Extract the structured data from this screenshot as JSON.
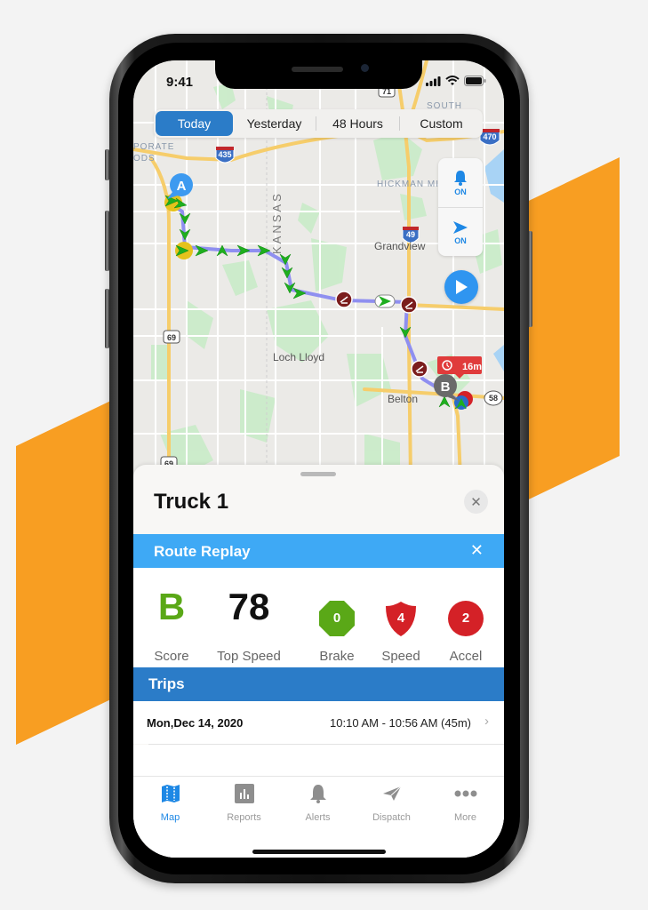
{
  "background": {
    "accent_color": "#F89E22"
  },
  "status_bar": {
    "time": "9:41"
  },
  "time_filter": {
    "options": [
      "Today",
      "Yesterday",
      "48 Hours",
      "Custom"
    ],
    "selected": "Today"
  },
  "map": {
    "labels": {
      "corporate_woods_1": "PORATE",
      "corporate_woods_2": "ODS",
      "south": "SOUTH",
      "hickman_mills": "HICKMAN MI",
      "kansas": "KANSAS",
      "grandview": "Grandview",
      "loch_lloyd": "Loch Lloyd",
      "belton": "Belton"
    },
    "shields": {
      "i435": "435",
      "i470": "470",
      "i49": "49",
      "us71": "71",
      "us69_top": "69",
      "us69_bottom": "69",
      "mo58": "58"
    },
    "markers": {
      "start": "A",
      "end": "B"
    },
    "stop_badge": "16m",
    "controls": {
      "alerts": {
        "icon": "bell-icon",
        "label": "ON"
      },
      "follow": {
        "icon": "location-arrow-icon",
        "label": "ON"
      },
      "play": {
        "icon": "play-icon"
      }
    },
    "colors": {
      "route": "#8f8ff0",
      "arrow": "#1fae1f",
      "event": "#7b1d1d",
      "road": "#f6cd6b"
    }
  },
  "sheet": {
    "title": "Truck 1",
    "route_replay": {
      "title": "Route Replay"
    },
    "stats": {
      "score": {
        "value": "B",
        "label": "Score",
        "color": "#5aa817"
      },
      "top_speed": {
        "value": "78",
        "label": "Top Speed"
      },
      "brake": {
        "value": "0",
        "label": "Brake",
        "color": "#5aa817"
      },
      "speed": {
        "value": "4",
        "label": "Speed",
        "color": "#d42127"
      },
      "accel": {
        "value": "2",
        "label": "Accel",
        "color": "#d42127"
      }
    },
    "trips": {
      "title": "Trips",
      "items": [
        {
          "date": "Mon,Dec 14, 2020",
          "time_range": "10:10 AM - 10:56 AM (45m)"
        }
      ]
    }
  },
  "tabbar": {
    "items": [
      {
        "label": "Map",
        "icon": "map-icon",
        "active": true
      },
      {
        "label": "Reports",
        "icon": "chart-icon",
        "active": false
      },
      {
        "label": "Alerts",
        "icon": "bell-icon",
        "active": false
      },
      {
        "label": "Dispatch",
        "icon": "paper-plane-icon",
        "active": false
      },
      {
        "label": "More",
        "icon": "more-dots-icon",
        "active": false
      }
    ]
  }
}
